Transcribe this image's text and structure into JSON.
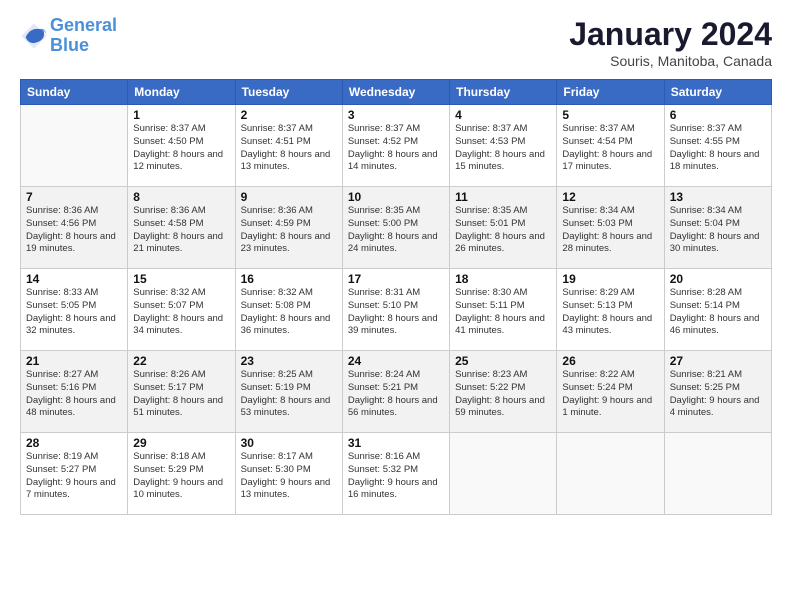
{
  "logo": {
    "line1": "General",
    "line2": "Blue"
  },
  "title": "January 2024",
  "location": "Souris, Manitoba, Canada",
  "days_of_week": [
    "Sunday",
    "Monday",
    "Tuesday",
    "Wednesday",
    "Thursday",
    "Friday",
    "Saturday"
  ],
  "weeks": [
    [
      {
        "day": "",
        "sunrise": "",
        "sunset": "",
        "daylight": ""
      },
      {
        "day": "1",
        "sunrise": "Sunrise: 8:37 AM",
        "sunset": "Sunset: 4:50 PM",
        "daylight": "Daylight: 8 hours and 12 minutes."
      },
      {
        "day": "2",
        "sunrise": "Sunrise: 8:37 AM",
        "sunset": "Sunset: 4:51 PM",
        "daylight": "Daylight: 8 hours and 13 minutes."
      },
      {
        "day": "3",
        "sunrise": "Sunrise: 8:37 AM",
        "sunset": "Sunset: 4:52 PM",
        "daylight": "Daylight: 8 hours and 14 minutes."
      },
      {
        "day": "4",
        "sunrise": "Sunrise: 8:37 AM",
        "sunset": "Sunset: 4:53 PM",
        "daylight": "Daylight: 8 hours and 15 minutes."
      },
      {
        "day": "5",
        "sunrise": "Sunrise: 8:37 AM",
        "sunset": "Sunset: 4:54 PM",
        "daylight": "Daylight: 8 hours and 17 minutes."
      },
      {
        "day": "6",
        "sunrise": "Sunrise: 8:37 AM",
        "sunset": "Sunset: 4:55 PM",
        "daylight": "Daylight: 8 hours and 18 minutes."
      }
    ],
    [
      {
        "day": "7",
        "sunrise": "Sunrise: 8:36 AM",
        "sunset": "Sunset: 4:56 PM",
        "daylight": "Daylight: 8 hours and 19 minutes."
      },
      {
        "day": "8",
        "sunrise": "Sunrise: 8:36 AM",
        "sunset": "Sunset: 4:58 PM",
        "daylight": "Daylight: 8 hours and 21 minutes."
      },
      {
        "day": "9",
        "sunrise": "Sunrise: 8:36 AM",
        "sunset": "Sunset: 4:59 PM",
        "daylight": "Daylight: 8 hours and 23 minutes."
      },
      {
        "day": "10",
        "sunrise": "Sunrise: 8:35 AM",
        "sunset": "Sunset: 5:00 PM",
        "daylight": "Daylight: 8 hours and 24 minutes."
      },
      {
        "day": "11",
        "sunrise": "Sunrise: 8:35 AM",
        "sunset": "Sunset: 5:01 PM",
        "daylight": "Daylight: 8 hours and 26 minutes."
      },
      {
        "day": "12",
        "sunrise": "Sunrise: 8:34 AM",
        "sunset": "Sunset: 5:03 PM",
        "daylight": "Daylight: 8 hours and 28 minutes."
      },
      {
        "day": "13",
        "sunrise": "Sunrise: 8:34 AM",
        "sunset": "Sunset: 5:04 PM",
        "daylight": "Daylight: 8 hours and 30 minutes."
      }
    ],
    [
      {
        "day": "14",
        "sunrise": "Sunrise: 8:33 AM",
        "sunset": "Sunset: 5:05 PM",
        "daylight": "Daylight: 8 hours and 32 minutes."
      },
      {
        "day": "15",
        "sunrise": "Sunrise: 8:32 AM",
        "sunset": "Sunset: 5:07 PM",
        "daylight": "Daylight: 8 hours and 34 minutes."
      },
      {
        "day": "16",
        "sunrise": "Sunrise: 8:32 AM",
        "sunset": "Sunset: 5:08 PM",
        "daylight": "Daylight: 8 hours and 36 minutes."
      },
      {
        "day": "17",
        "sunrise": "Sunrise: 8:31 AM",
        "sunset": "Sunset: 5:10 PM",
        "daylight": "Daylight: 8 hours and 39 minutes."
      },
      {
        "day": "18",
        "sunrise": "Sunrise: 8:30 AM",
        "sunset": "Sunset: 5:11 PM",
        "daylight": "Daylight: 8 hours and 41 minutes."
      },
      {
        "day": "19",
        "sunrise": "Sunrise: 8:29 AM",
        "sunset": "Sunset: 5:13 PM",
        "daylight": "Daylight: 8 hours and 43 minutes."
      },
      {
        "day": "20",
        "sunrise": "Sunrise: 8:28 AM",
        "sunset": "Sunset: 5:14 PM",
        "daylight": "Daylight: 8 hours and 46 minutes."
      }
    ],
    [
      {
        "day": "21",
        "sunrise": "Sunrise: 8:27 AM",
        "sunset": "Sunset: 5:16 PM",
        "daylight": "Daylight: 8 hours and 48 minutes."
      },
      {
        "day": "22",
        "sunrise": "Sunrise: 8:26 AM",
        "sunset": "Sunset: 5:17 PM",
        "daylight": "Daylight: 8 hours and 51 minutes."
      },
      {
        "day": "23",
        "sunrise": "Sunrise: 8:25 AM",
        "sunset": "Sunset: 5:19 PM",
        "daylight": "Daylight: 8 hours and 53 minutes."
      },
      {
        "day": "24",
        "sunrise": "Sunrise: 8:24 AM",
        "sunset": "Sunset: 5:21 PM",
        "daylight": "Daylight: 8 hours and 56 minutes."
      },
      {
        "day": "25",
        "sunrise": "Sunrise: 8:23 AM",
        "sunset": "Sunset: 5:22 PM",
        "daylight": "Daylight: 8 hours and 59 minutes."
      },
      {
        "day": "26",
        "sunrise": "Sunrise: 8:22 AM",
        "sunset": "Sunset: 5:24 PM",
        "daylight": "Daylight: 9 hours and 1 minute."
      },
      {
        "day": "27",
        "sunrise": "Sunrise: 8:21 AM",
        "sunset": "Sunset: 5:25 PM",
        "daylight": "Daylight: 9 hours and 4 minutes."
      }
    ],
    [
      {
        "day": "28",
        "sunrise": "Sunrise: 8:19 AM",
        "sunset": "Sunset: 5:27 PM",
        "daylight": "Daylight: 9 hours and 7 minutes."
      },
      {
        "day": "29",
        "sunrise": "Sunrise: 8:18 AM",
        "sunset": "Sunset: 5:29 PM",
        "daylight": "Daylight: 9 hours and 10 minutes."
      },
      {
        "day": "30",
        "sunrise": "Sunrise: 8:17 AM",
        "sunset": "Sunset: 5:30 PM",
        "daylight": "Daylight: 9 hours and 13 minutes."
      },
      {
        "day": "31",
        "sunrise": "Sunrise: 8:16 AM",
        "sunset": "Sunset: 5:32 PM",
        "daylight": "Daylight: 9 hours and 16 minutes."
      },
      {
        "day": "",
        "sunrise": "",
        "sunset": "",
        "daylight": ""
      },
      {
        "day": "",
        "sunrise": "",
        "sunset": "",
        "daylight": ""
      },
      {
        "day": "",
        "sunrise": "",
        "sunset": "",
        "daylight": ""
      }
    ]
  ],
  "row_shades": [
    false,
    true,
    false,
    true,
    false
  ]
}
